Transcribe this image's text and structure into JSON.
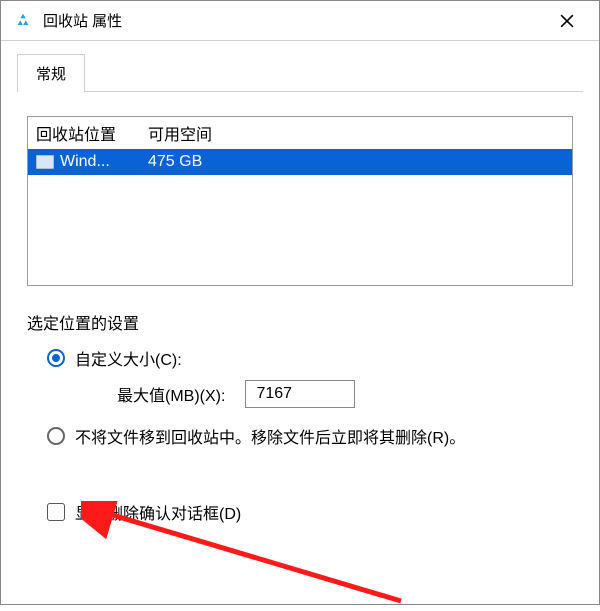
{
  "window": {
    "title": "回收站 属性"
  },
  "tabs": {
    "general": "常规"
  },
  "list": {
    "header_location": "回收站位置",
    "header_space": "可用空间",
    "rows": [
      {
        "name": "Wind...",
        "space": "475 GB",
        "selected": true
      }
    ]
  },
  "settings": {
    "section_label": "选定位置的设置",
    "custom_size_label": "自定义大小(C):",
    "max_label": "最大值(MB)(X):",
    "max_value": "7167",
    "no_move_label": "不将文件移到回收站中。移除文件后立即将其删除(R)。",
    "confirm_label": "显示删除确认对话框(D)"
  }
}
